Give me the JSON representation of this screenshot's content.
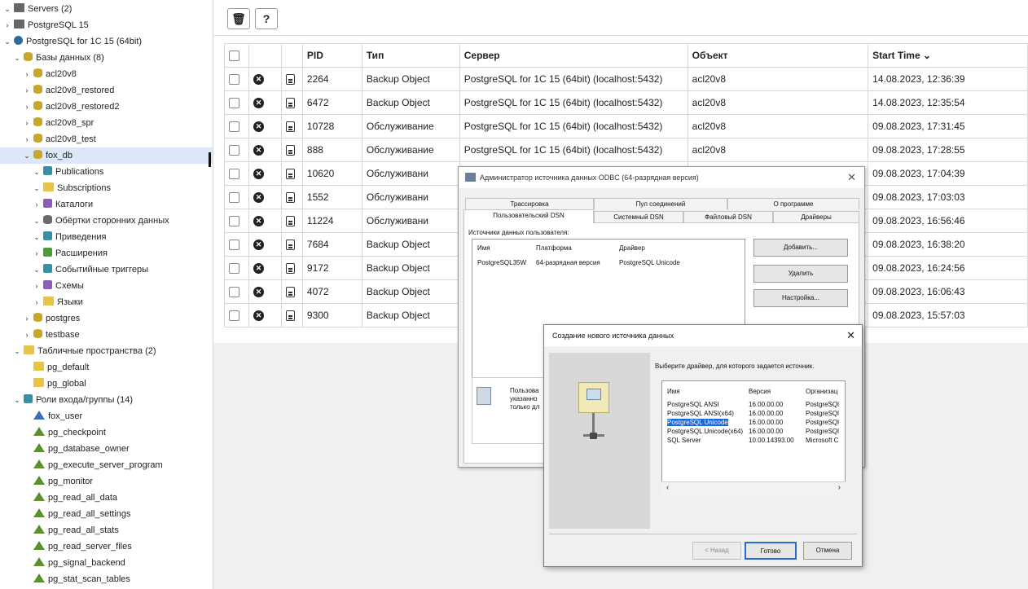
{
  "sidebar": {
    "tree": [
      {
        "label": "Servers (2)",
        "icon": "server-icon",
        "chev": "⌄"
      },
      {
        "label": "PostgreSQL 15",
        "icon": "server-icon",
        "chev": "›"
      },
      {
        "label": "PostgreSQL for 1C 15 (64bit)",
        "icon": "elephant-icon",
        "chev": "⌄"
      },
      {
        "label": "Базы данных (8)",
        "icon": "database-icon",
        "chev": "⌄"
      },
      {
        "label": "acl20v8",
        "icon": "database-icon",
        "chev": "›"
      },
      {
        "label": "acl20v8_restored",
        "icon": "database-icon",
        "chev": "›"
      },
      {
        "label": "acl20v8_restored2",
        "icon": "database-icon",
        "chev": "›"
      },
      {
        "label": "acl20v8_spr",
        "icon": "database-icon",
        "chev": "›"
      },
      {
        "label": "acl20v8_test",
        "icon": "database-icon",
        "chev": "›"
      },
      {
        "label": "fox_db",
        "icon": "database-icon",
        "chev": "⌄"
      },
      {
        "label": "Publications",
        "icon": "publication-icon",
        "chev": "⌄"
      },
      {
        "label": "Subscriptions",
        "icon": "subscription-icon",
        "chev": "⌄"
      },
      {
        "label": "Каталоги",
        "icon": "catalog-icon",
        "chev": "›"
      },
      {
        "label": "Обёртки сторонних данных",
        "icon": "fdw-icon",
        "chev": "⌄"
      },
      {
        "label": "Приведения",
        "icon": "cast-icon",
        "chev": "⌄"
      },
      {
        "label": "Расширения",
        "icon": "extension-icon",
        "chev": "›"
      },
      {
        "label": "Событийные триггеры",
        "icon": "event-trigger-icon",
        "chev": "⌄"
      },
      {
        "label": "Схемы",
        "icon": "schema-icon",
        "chev": "›"
      },
      {
        "label": "Языки",
        "icon": "language-icon",
        "chev": "›"
      },
      {
        "label": "postgres",
        "icon": "database-icon",
        "chev": "›"
      },
      {
        "label": "testbase",
        "icon": "database-icon",
        "chev": "›"
      },
      {
        "label": "Табличные пространства (2)",
        "icon": "tablespace-icon",
        "chev": "⌄"
      },
      {
        "label": "pg_default",
        "icon": "folder-icon",
        "chev": ""
      },
      {
        "label": "pg_global",
        "icon": "folder-icon",
        "chev": ""
      },
      {
        "label": "Роли входа/группы (14)",
        "icon": "roles-icon",
        "chev": "⌄"
      },
      {
        "label": "fox_user",
        "icon": "user-role-icon",
        "chev": ""
      },
      {
        "label": "pg_checkpoint",
        "icon": "group-role-icon",
        "chev": ""
      },
      {
        "label": "pg_database_owner",
        "icon": "group-role-icon",
        "chev": ""
      },
      {
        "label": "pg_execute_server_program",
        "icon": "group-role-icon",
        "chev": ""
      },
      {
        "label": "pg_monitor",
        "icon": "group-role-icon",
        "chev": ""
      },
      {
        "label": "pg_read_all_data",
        "icon": "group-role-icon",
        "chev": ""
      },
      {
        "label": "pg_read_all_settings",
        "icon": "group-role-icon",
        "chev": ""
      },
      {
        "label": "pg_read_all_stats",
        "icon": "group-role-icon",
        "chev": ""
      },
      {
        "label": "pg_read_server_files",
        "icon": "group-role-icon",
        "chev": ""
      },
      {
        "label": "pg_signal_backend",
        "icon": "group-role-icon",
        "chev": ""
      },
      {
        "label": "pg_stat_scan_tables",
        "icon": "group-role-icon",
        "chev": ""
      }
    ]
  },
  "toolbar": {
    "delete_glyph": "🗑",
    "help_glyph": "?"
  },
  "grid": {
    "columns": [
      "PID",
      "Тип",
      "Сервер",
      "Объект",
      "Start Time ⌄"
    ],
    "rows": [
      {
        "pid": "2264",
        "type": "Backup Object",
        "server": "PostgreSQL for 1C 15 (64bit) (localhost:5432)",
        "object": "acl20v8",
        "start": "14.08.2023, 12:36:39"
      },
      {
        "pid": "6472",
        "type": "Backup Object",
        "server": "PostgreSQL for 1C 15 (64bit) (localhost:5432)",
        "object": "acl20v8",
        "start": "14.08.2023, 12:35:54"
      },
      {
        "pid": "10728",
        "type": "Обслуживание",
        "server": "PostgreSQL for 1C 15 (64bit) (localhost:5432)",
        "object": "acl20v8",
        "start": "09.08.2023, 17:31:45"
      },
      {
        "pid": "888",
        "type": "Обслуживание",
        "server": "PostgreSQL for 1C 15 (64bit) (localhost:5432)",
        "object": "acl20v8",
        "start": "09.08.2023, 17:28:55"
      },
      {
        "pid": "10620",
        "type": "Обслуживани",
        "server": "",
        "object": "",
        "start": "09.08.2023, 17:04:39"
      },
      {
        "pid": "1552",
        "type": "Обслуживани",
        "server": "",
        "object": "",
        "start": "09.08.2023, 17:03:03"
      },
      {
        "pid": "11224",
        "type": "Обслуживани",
        "server": "",
        "object": "",
        "start": "09.08.2023, 16:56:46"
      },
      {
        "pid": "7684",
        "type": "Backup Object",
        "server": "",
        "object": "",
        "start": "09.08.2023, 16:38:20"
      },
      {
        "pid": "9172",
        "type": "Backup Object",
        "server": "",
        "object": "",
        "start": "09.08.2023, 16:24:56"
      },
      {
        "pid": "4072",
        "type": "Backup Object",
        "server": "",
        "object": "",
        "start": "09.08.2023, 16:06:43"
      },
      {
        "pid": "9300",
        "type": "Backup Object",
        "server": "",
        "object": "",
        "start": "09.08.2023, 15:57:03"
      }
    ]
  },
  "odbc": {
    "title": "Администратор источника данных ODBC (64-разрядная версия)",
    "close": "✕",
    "tabs_row1": [
      "Трассировка",
      "Пул соединений",
      "О программе"
    ],
    "tabs_row2": [
      "Пользовательский DSN",
      "Системный DSN",
      "Файловый DSN",
      "Драйверы"
    ],
    "list_label": "Источники данных пользователя:",
    "headers": [
      "Имя",
      "Платформа",
      "Драйвер"
    ],
    "row": [
      "PostgreSQL35W",
      "64-разрядная версия",
      "PostgreSQL Unicode"
    ],
    "buttons": [
      "Добавить...",
      "Удалить",
      "Настройка..."
    ],
    "info": [
      "Пользова",
      "указанно",
      "только дл"
    ]
  },
  "nds": {
    "title": "Создание нового источника данных",
    "close": "✕",
    "prompt": "Выберите драйвер, для которого задается источник.",
    "headers": [
      "Имя",
      "Версия",
      "Организац"
    ],
    "rows": [
      [
        "PostgreSQL ANSI",
        "16.00.00.00",
        "PostgreSQl"
      ],
      [
        "PostgreSQL ANSI(x64)",
        "16.00.00.00",
        "PostgreSQl"
      ],
      [
        "PostgreSQL Unicode",
        "16.00.00.00",
        "PostgreSQl"
      ],
      [
        "PostgreSQL Unicode(x64)",
        "16.00.00.00",
        "PostgreSQl"
      ],
      [
        "SQL Server",
        "10.00.14393.00",
        "Microsoft C"
      ]
    ],
    "selected_index": 2,
    "scroll_left": "‹",
    "scroll_right": "›",
    "buttons": [
      "< Назад",
      "Готово",
      "Отмена"
    ]
  }
}
